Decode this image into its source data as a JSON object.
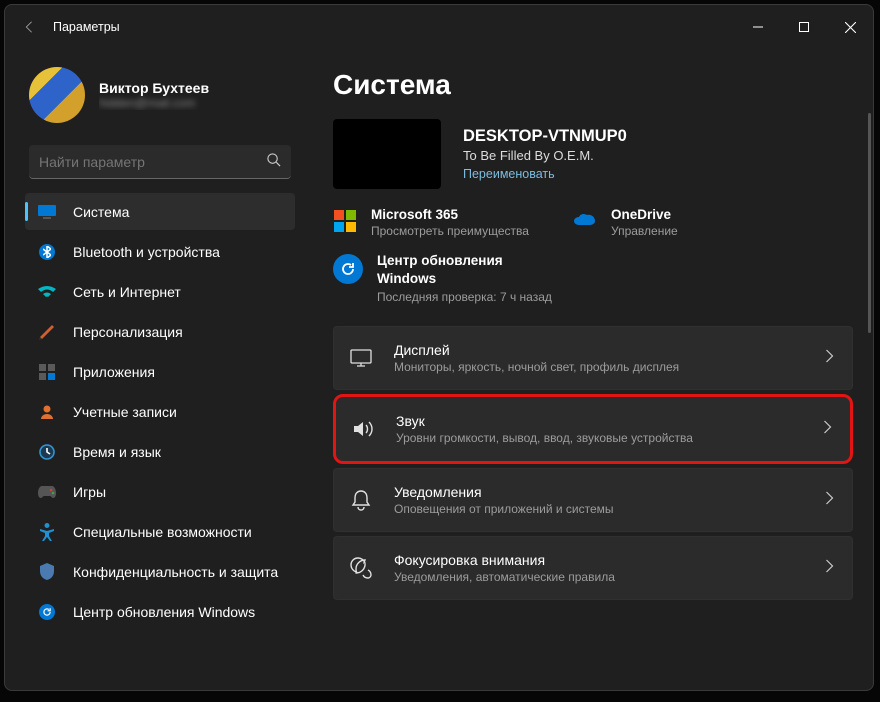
{
  "window": {
    "title": "Параметры"
  },
  "user": {
    "name": "Виктор Бухтеев",
    "email": "hidden@mail.com"
  },
  "search": {
    "placeholder": "Найти параметр"
  },
  "nav": [
    {
      "label": "Система",
      "active": true,
      "icon": "system"
    },
    {
      "label": "Bluetooth и устройства",
      "active": false,
      "icon": "bluetooth"
    },
    {
      "label": "Сеть и Интернет",
      "active": false,
      "icon": "network"
    },
    {
      "label": "Персонализация",
      "active": false,
      "icon": "personalization"
    },
    {
      "label": "Приложения",
      "active": false,
      "icon": "apps"
    },
    {
      "label": "Учетные записи",
      "active": false,
      "icon": "accounts"
    },
    {
      "label": "Время и язык",
      "active": false,
      "icon": "time"
    },
    {
      "label": "Игры",
      "active": false,
      "icon": "gaming"
    },
    {
      "label": "Специальные возможности",
      "active": false,
      "icon": "accessibility"
    },
    {
      "label": "Конфиденциальность и защита",
      "active": false,
      "icon": "privacy"
    },
    {
      "label": "Центр обновления Windows",
      "active": false,
      "icon": "update"
    }
  ],
  "page": {
    "title": "Система"
  },
  "device": {
    "name": "DESKTOP-VTNMUP0",
    "sub": "To Be Filled By O.E.M.",
    "rename": "Переименовать"
  },
  "tiles": {
    "m365": {
      "title": "Microsoft 365",
      "sub": "Просмотреть преимущества"
    },
    "onedrive": {
      "title": "OneDrive",
      "sub": "Управление"
    },
    "update": {
      "title": "Центр обновления Windows",
      "sub": "Последняя проверка: 7 ч назад"
    }
  },
  "cards": [
    {
      "key": "display",
      "title": "Дисплей",
      "sub": "Мониторы, яркость, ночной свет, профиль дисплея",
      "hl": false
    },
    {
      "key": "sound",
      "title": "Звук",
      "sub": "Уровни громкости, вывод, ввод, звуковые устройства",
      "hl": true
    },
    {
      "key": "notifications",
      "title": "Уведомления",
      "sub": "Оповещения от приложений и системы",
      "hl": false
    },
    {
      "key": "focus",
      "title": "Фокусировка внимания",
      "sub": "Уведомления, автоматические правила",
      "hl": false
    }
  ]
}
